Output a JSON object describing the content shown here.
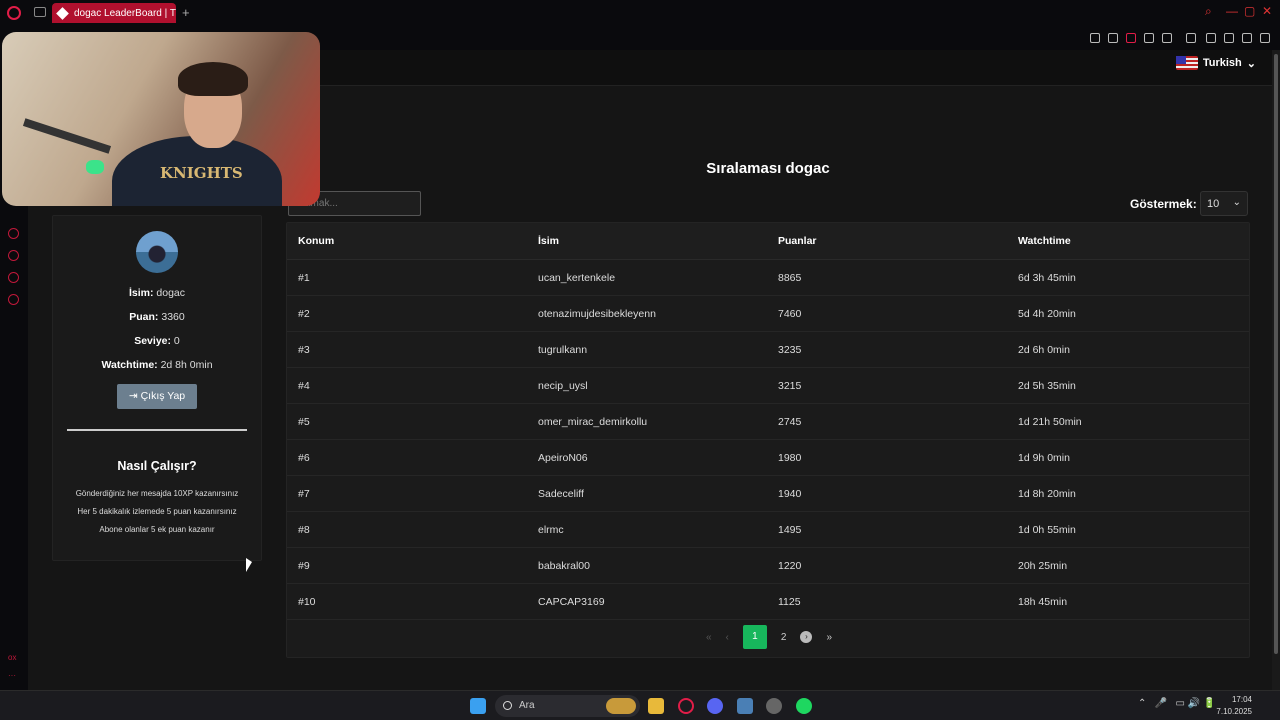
{
  "browser": {
    "tab_title": "dogac LeaderBoard | The",
    "new_tab": "+"
  },
  "header": {
    "language": "Turkish",
    "language_chevron": "⌄"
  },
  "webcam": {
    "shirt_text": "KNIGHTS"
  },
  "leaderboard": {
    "title": "Sıralaması dogac",
    "search_placeholder": "Aramak...",
    "show_label": "Göstermek:",
    "show_value": "10",
    "columns": [
      "Konum",
      "İsim",
      "Puanlar",
      "Watchtime"
    ],
    "rows": [
      [
        "#1",
        "ucan_kertenkele",
        "8865",
        "6d 3h 45min"
      ],
      [
        "#2",
        "otenazimujdesibekleyenn",
        "7460",
        "5d 4h 20min"
      ],
      [
        "#3",
        "tugrulkann",
        "3235",
        "2d 6h 0min"
      ],
      [
        "#4",
        "necip_uysl",
        "3215",
        "2d 5h 35min"
      ],
      [
        "#5",
        "omer_mirac_demirkollu",
        "2745",
        "1d 21h 50min"
      ],
      [
        "#6",
        "ApeiroN06",
        "1980",
        "1d 9h 0min"
      ],
      [
        "#7",
        "Sadeceliff",
        "1940",
        "1d 8h 20min"
      ],
      [
        "#8",
        "elrmc",
        "1495",
        "1d 0h 55min"
      ],
      [
        "#9",
        "babakral00",
        "1220",
        "20h 25min"
      ],
      [
        "#10",
        "CAPCAP3169",
        "1125",
        "18h 45min"
      ]
    ],
    "pagination": {
      "first": "«",
      "prev": "‹",
      "pages": [
        "1",
        "2"
      ],
      "current": "1",
      "next": "›",
      "last": "»"
    }
  },
  "profile": {
    "name_label": "İsim:",
    "name": "dogac",
    "points_label": "Puan:",
    "points": "3360",
    "level_label": "Seviye:",
    "level": "0",
    "watchtime_label": "Watchtime:",
    "watchtime": "2d 8h 0min",
    "logout_label": "Çıkış Yap",
    "how_title": "Nasıl Çalışır?",
    "how_lines": [
      "Gönderdiğiniz her mesajda 10XP kazanırsınız",
      "Her 5 dakikalık izlemede 5 puan kazanırsınız",
      "Abone olanlar 5 ek puan kazanır"
    ]
  },
  "sidebar": {
    "bottom_text": "ox",
    "more": "···"
  },
  "taskbar": {
    "search_label": "Ara",
    "time": "17:04",
    "date": "7.10.2025"
  },
  "colors": {
    "accent_red": "#e11d48",
    "active_page_green": "#17b75c",
    "logout_button": "#6c7f8f"
  }
}
